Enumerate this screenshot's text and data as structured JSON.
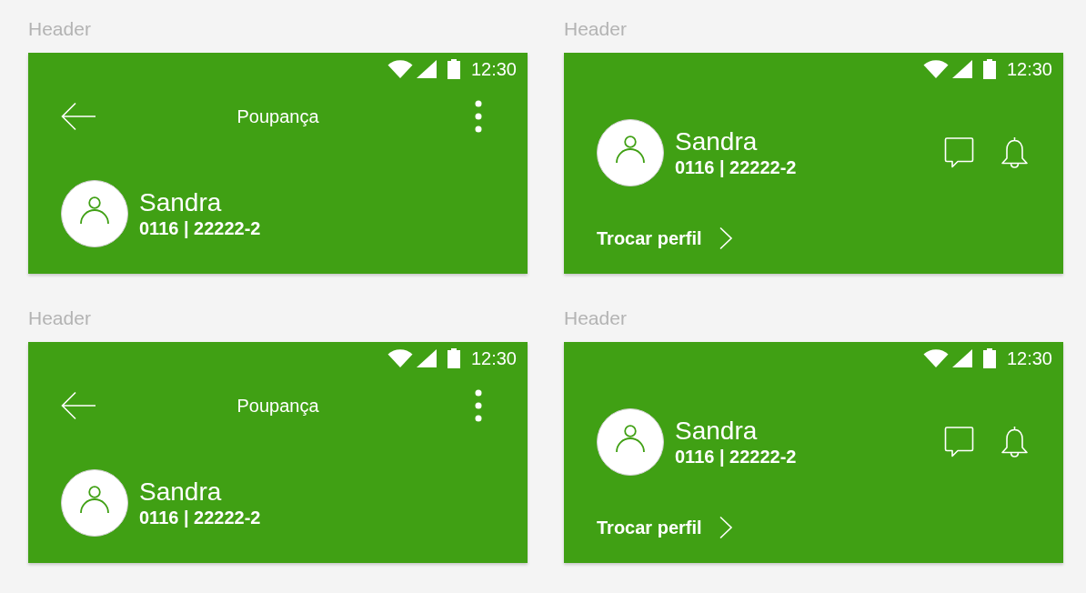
{
  "headers": [
    {
      "kind": "detail",
      "label": "Header",
      "status_bar": {
        "time": "12:30"
      },
      "title": "Poupança",
      "profile": {
        "name": "Sandra",
        "account": "0116 | 22222-2"
      }
    },
    {
      "kind": "home",
      "label": "Header",
      "status_bar": {
        "time": "12:30"
      },
      "profile": {
        "name": "Sandra",
        "account": "0116 | 22222-2"
      },
      "switch_profile": "Trocar perfil"
    },
    {
      "kind": "detail",
      "label": "Header",
      "status_bar": {
        "time": "12:30"
      },
      "title": "Poupança",
      "profile": {
        "name": "Sandra",
        "account": "0116 | 22222-2"
      }
    },
    {
      "kind": "home",
      "label": "Header",
      "status_bar": {
        "time": "12:30"
      },
      "profile": {
        "name": "Sandra",
        "account": "0116 | 22222-2"
      },
      "switch_profile": "Trocar perfil"
    }
  ]
}
